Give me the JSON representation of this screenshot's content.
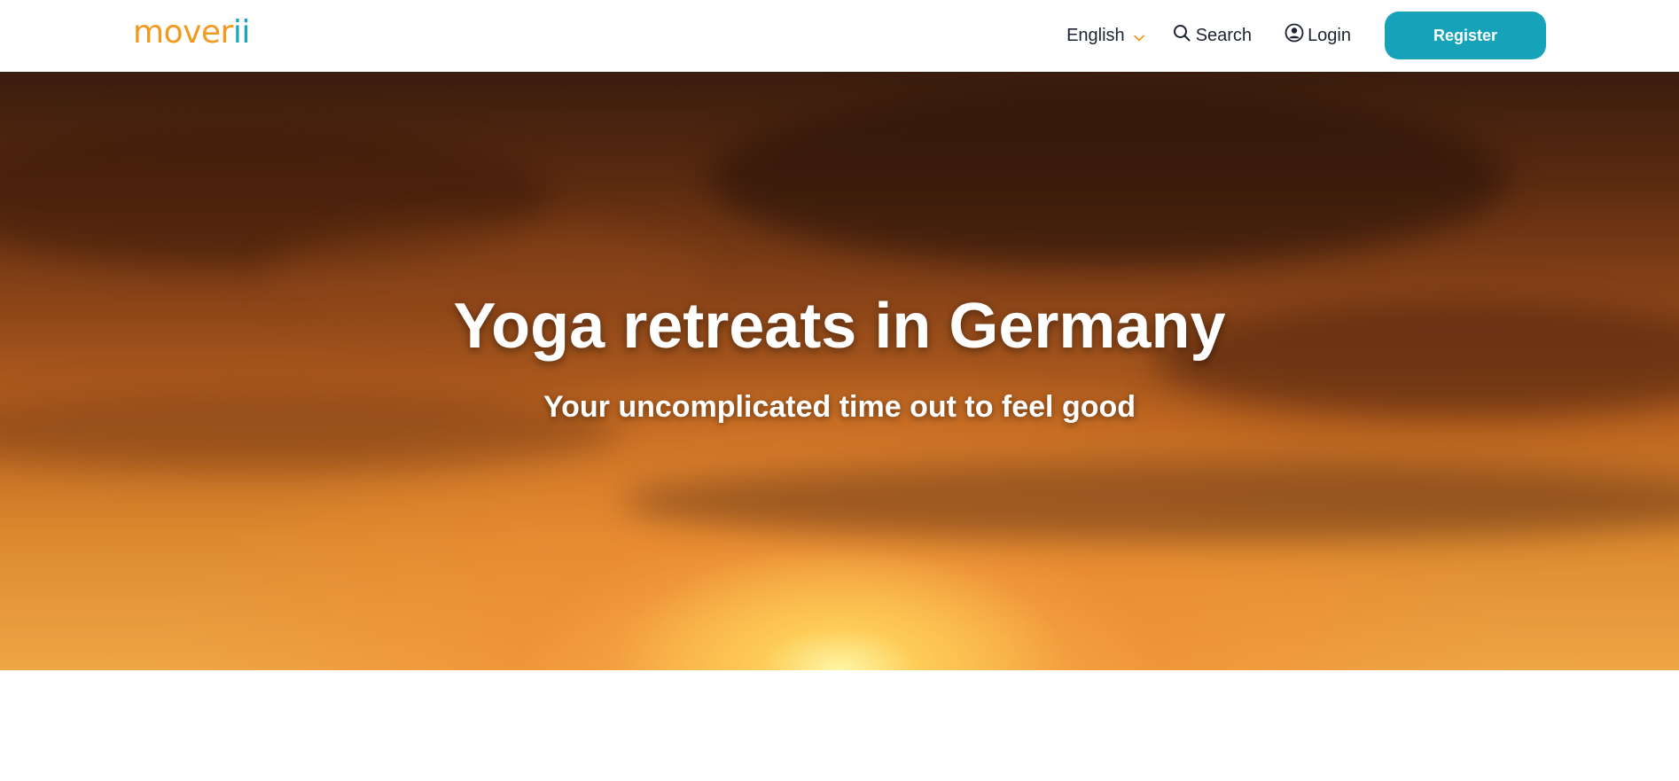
{
  "header": {
    "logo": {
      "main": "mover",
      "accent": "ii"
    },
    "language": {
      "label": "English",
      "icon": "chevron-down-icon"
    },
    "search": {
      "label": "Search",
      "icon": "search-icon"
    },
    "login": {
      "label": "Login",
      "icon": "user-circle-icon"
    },
    "register": {
      "label": "Register"
    }
  },
  "hero": {
    "title": "Yoga retreats in Germany",
    "subtitle": "Your uncomplicated time out to feel good"
  },
  "colors": {
    "brand_orange": "#f39a1e",
    "brand_teal": "#16a2b8",
    "text_dark": "#1b2230",
    "hero_text": "#ffffff"
  }
}
